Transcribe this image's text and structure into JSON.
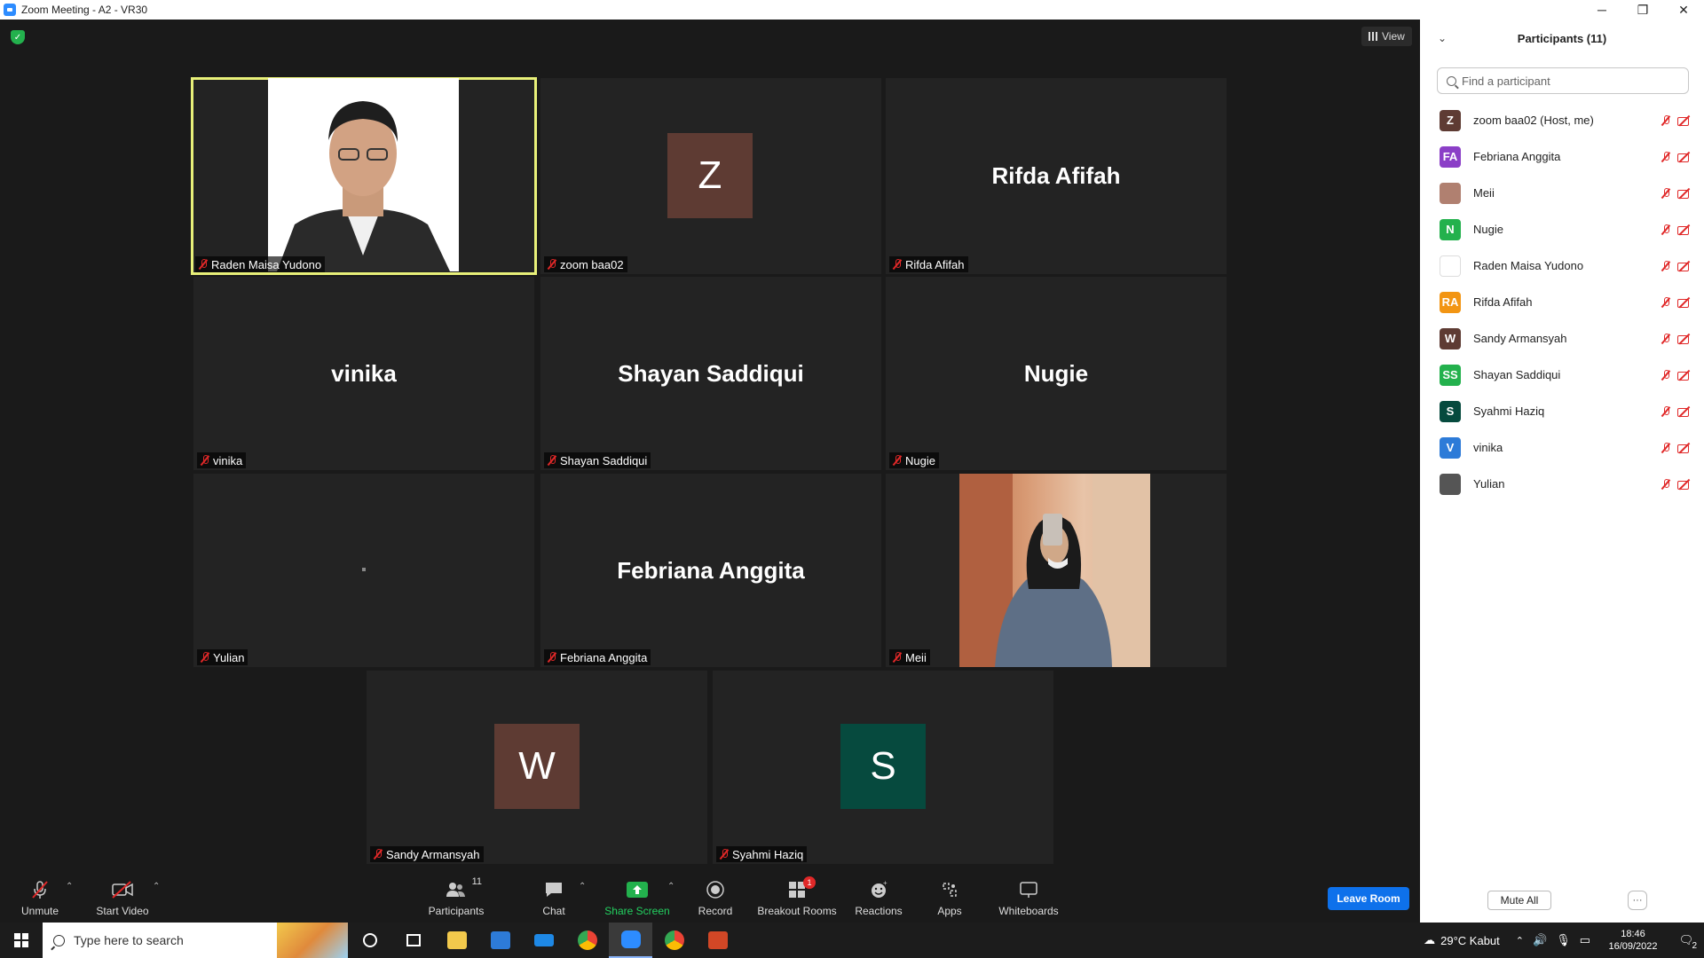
{
  "window": {
    "title": "Zoom Meeting - A2 - VR30",
    "minimize": "─",
    "restore": "❐",
    "close": "✕"
  },
  "view_button": {
    "label": "View"
  },
  "tiles": [
    {
      "name": "Raden Maisa Yudono",
      "type": "photo-man",
      "active": true
    },
    {
      "name": "zoom baa02",
      "type": "avatar",
      "initial": "Z",
      "color": "#5e3b33"
    },
    {
      "name": "Rifda Afifah",
      "type": "bigname",
      "display": "Rifda Afifah"
    },
    {
      "name": "vinika",
      "type": "bigname",
      "display": "vinika"
    },
    {
      "name": "Shayan Saddiqui",
      "type": "bigname",
      "display": "Shayan Saddiqui"
    },
    {
      "name": "Nugie",
      "type": "bigname",
      "display": "Nugie"
    },
    {
      "name": "Yulian",
      "type": "blank"
    },
    {
      "name": "Febriana Anggita",
      "type": "bigname",
      "display": "Febriana Anggita"
    },
    {
      "name": "Meii",
      "type": "photo-woman"
    },
    {
      "name": "Sandy Armansyah",
      "type": "avatar",
      "initial": "W",
      "color": "#5e3b33"
    },
    {
      "name": "Syahmi Haziq",
      "type": "avatar",
      "initial": "S",
      "color": "#064a3e"
    }
  ],
  "toolbar": {
    "unmute": "Unmute",
    "start_video": "Start Video",
    "participants": "Participants",
    "participants_count": "11",
    "chat": "Chat",
    "share_screen": "Share Screen",
    "record": "Record",
    "breakout_rooms": "Breakout Rooms",
    "breakout_badge": "1",
    "reactions": "Reactions",
    "apps": "Apps",
    "whiteboards": "Whiteboards",
    "leave": "Leave Room"
  },
  "panel": {
    "title": "Participants (11)",
    "search_placeholder": "Find a participant",
    "mute_all": "Mute All",
    "more": "···",
    "participants": [
      {
        "name": "zoom baa02 (Host, me)",
        "initials": "Z",
        "color": "#5e3b33"
      },
      {
        "name": "Febriana Anggita",
        "initials": "FA",
        "color": "#8b3fc7"
      },
      {
        "name": "Meii",
        "initials": "",
        "color": "#b08070"
      },
      {
        "name": "Nugie",
        "initials": "N",
        "color": "#23b14d"
      },
      {
        "name": "Raden Maisa Yudono",
        "initials": "",
        "color": "#ffffff"
      },
      {
        "name": "Rifda Afifah",
        "initials": "RA",
        "color": "#f29513"
      },
      {
        "name": "Sandy Armansyah",
        "initials": "W",
        "color": "#5e3b33"
      },
      {
        "name": "Shayan Saddiqui",
        "initials": "SS",
        "color": "#23b14d"
      },
      {
        "name": "Syahmi Haziq",
        "initials": "S",
        "color": "#064a3e"
      },
      {
        "name": "vinika",
        "initials": "V",
        "color": "#2d7bd8"
      },
      {
        "name": "Yulian",
        "initials": "",
        "color": "#555555"
      }
    ]
  },
  "taskbar": {
    "search_placeholder": "Type here to search",
    "weather": "29°C  Kabut",
    "time": "18:46",
    "date": "16/09/2022",
    "notifications": "2"
  }
}
